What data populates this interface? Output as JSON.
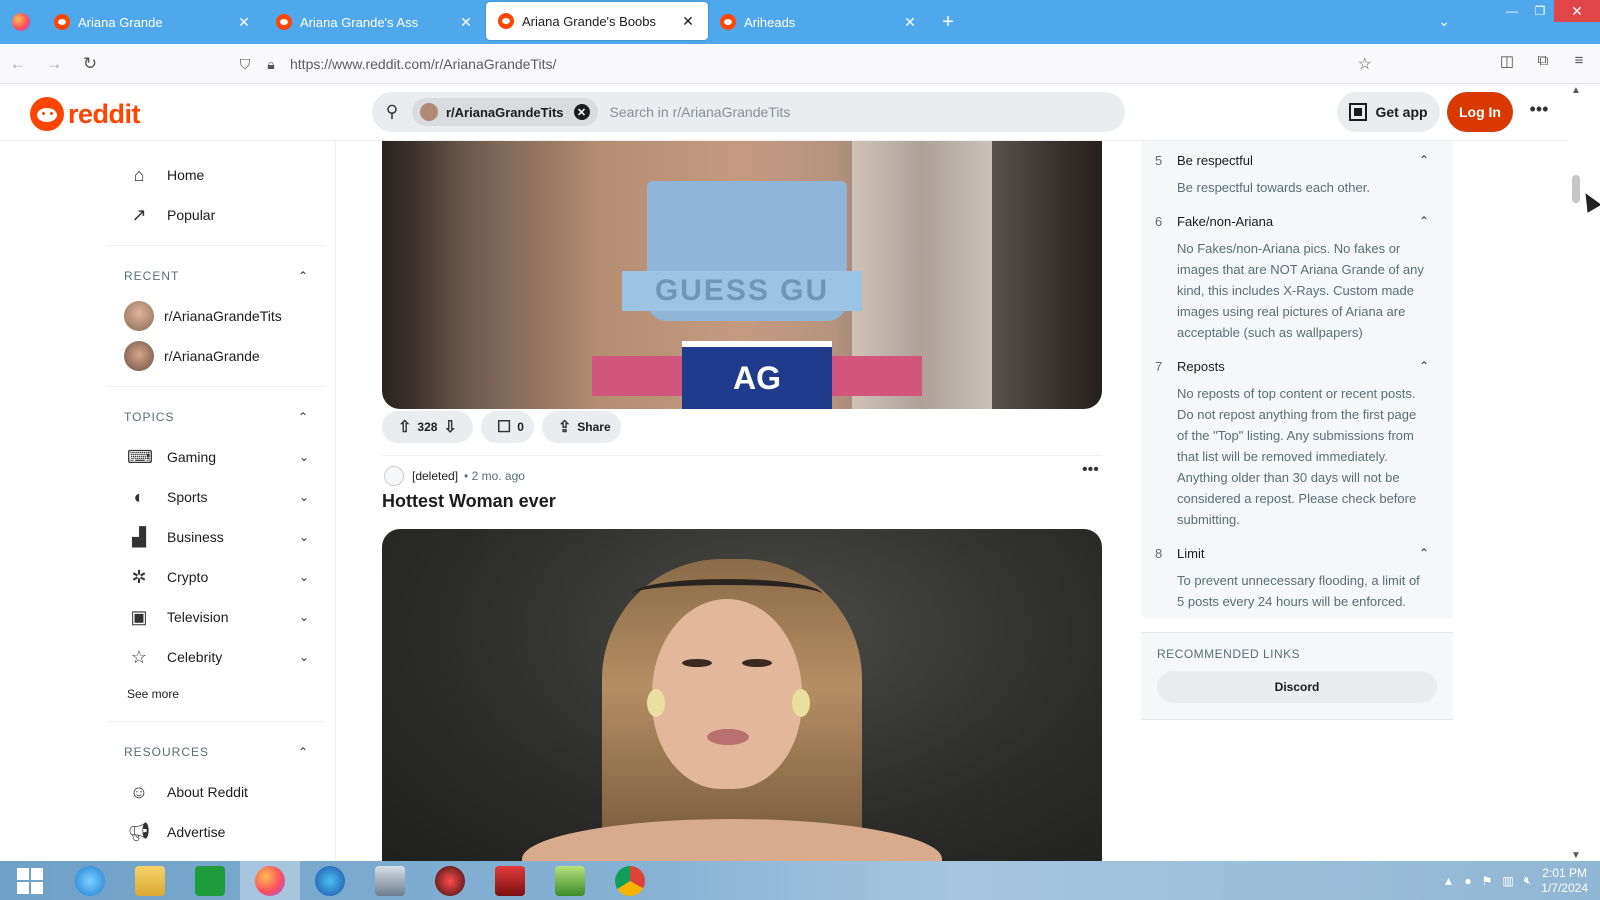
{
  "browser": {
    "tabs": [
      {
        "label": "Ariana Grande",
        "close": "✕"
      },
      {
        "label": "Ariana Grande's Ass",
        "close": "✕"
      },
      {
        "label": "Ariana Grande's Boobs",
        "close": "✕"
      },
      {
        "label": "Ariheads",
        "close": "✕"
      }
    ],
    "url": "https://www.reddit.com/r/ArianaGrandeTits/"
  },
  "header": {
    "logo_text": "reddit",
    "search_chip": "r/ArianaGrandeTits",
    "search_placeholder": "Search in r/ArianaGrandeTits",
    "get_app": "Get app",
    "login": "Log In"
  },
  "sidebar": {
    "nav": [
      {
        "label": "Home",
        "icon": "home-icon"
      },
      {
        "label": "Popular",
        "icon": "popular-icon"
      }
    ],
    "recent_title": "RECENT",
    "recent": [
      {
        "label": "r/ArianaGrandeTits"
      },
      {
        "label": "r/ArianaGrande"
      }
    ],
    "topics_title": "TOPICS",
    "topics": [
      {
        "label": "Gaming",
        "icon": "gamepad-icon"
      },
      {
        "label": "Sports",
        "icon": "sports-icon"
      },
      {
        "label": "Business",
        "icon": "chart-icon"
      },
      {
        "label": "Crypto",
        "icon": "crypto-icon"
      },
      {
        "label": "Television",
        "icon": "tv-icon"
      },
      {
        "label": "Celebrity",
        "icon": "star-icon"
      }
    ],
    "see_more": "See more",
    "resources_title": "RESOURCES",
    "resources": [
      {
        "label": "About Reddit",
        "icon": "reddit-icon"
      },
      {
        "label": "Advertise",
        "icon": "megaphone-icon"
      }
    ]
  },
  "feed": {
    "post1": {
      "image_text_band": "GUESS GU",
      "image_text_belt": "AG",
      "votes": "328",
      "comments": "0",
      "share": "Share"
    },
    "post2": {
      "author": "[deleted]",
      "time": "• 2 mo. ago",
      "title": "Hottest Woman ever"
    }
  },
  "rules": [
    {
      "num": "5",
      "title": "Be respectful",
      "body": "Be respectful towards each other."
    },
    {
      "num": "6",
      "title": "Fake/non-Ariana",
      "body": "No Fakes/non-Ariana pics. No fakes or images that are NOT Ariana Grande of any kind, this includes X-Rays. Custom made images using real pictures of Ariana are acceptable (such as wallpapers)"
    },
    {
      "num": "7",
      "title": "Reposts",
      "body": "No reposts of top content or recent posts. Do not repost anything from the first page of the \"Top\" listing. Any submissions from that list will be removed immediately. Anything older than 30 days will not be considered a repost. Please check before submitting."
    },
    {
      "num": "8",
      "title": "Limit",
      "body": "To prevent unnecessary flooding, a limit of 5 posts every 24 hours will be enforced."
    }
  ],
  "recommended": {
    "title": "RECOMMENDED LINKS",
    "discord": "Discord"
  },
  "taskbar": {
    "time": "2:01 PM",
    "date": "1/7/2024"
  }
}
